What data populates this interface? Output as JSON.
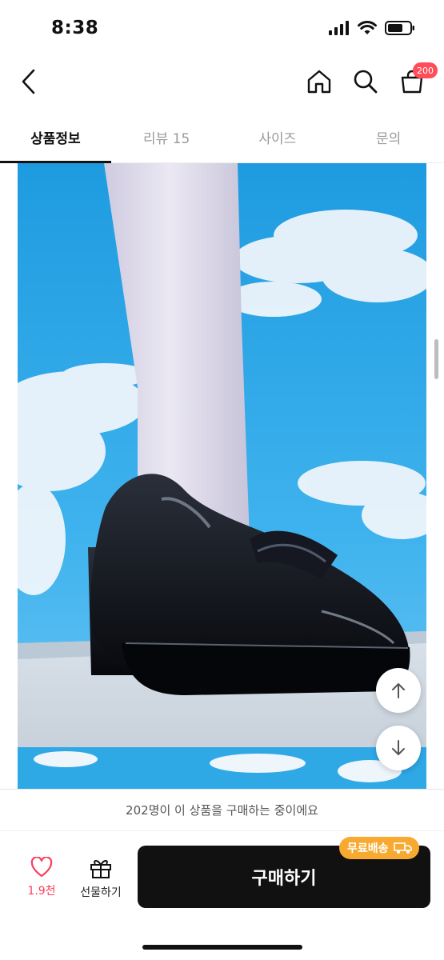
{
  "status_bar": {
    "time": "8:38",
    "icons": [
      "signal-icon",
      "wifi-icon",
      "battery-icon"
    ]
  },
  "nav": {
    "icons": [
      "back-icon",
      "home-icon",
      "search-icon",
      "cart-icon"
    ],
    "cart_badge": "200"
  },
  "tabs": [
    {
      "label": "상품정보",
      "active": true
    },
    {
      "label": "리뷰 15",
      "active": false
    },
    {
      "label": "사이즈",
      "active": false
    },
    {
      "label": "문의",
      "active": false
    }
  ],
  "product_image": {
    "subject": "black patent platform loafer heel on sky background"
  },
  "floating": {
    "up_icon": "arrow-up-icon",
    "down_icon": "arrow-down-icon"
  },
  "notice": {
    "text": "202명이 이 상품을 구매하는 중이에요"
  },
  "bottom_bar": {
    "like_count": "1.9천",
    "gift_label": "선물하기",
    "buy_label": "구매하기",
    "shipping_tag": "무료배송"
  },
  "colors": {
    "accent_red": "#ff3b5c",
    "badge_red": "#ff4d5a",
    "shipping_orange": "#f8a92f",
    "buy_button": "#111111",
    "sky": "#2fa8e6"
  }
}
